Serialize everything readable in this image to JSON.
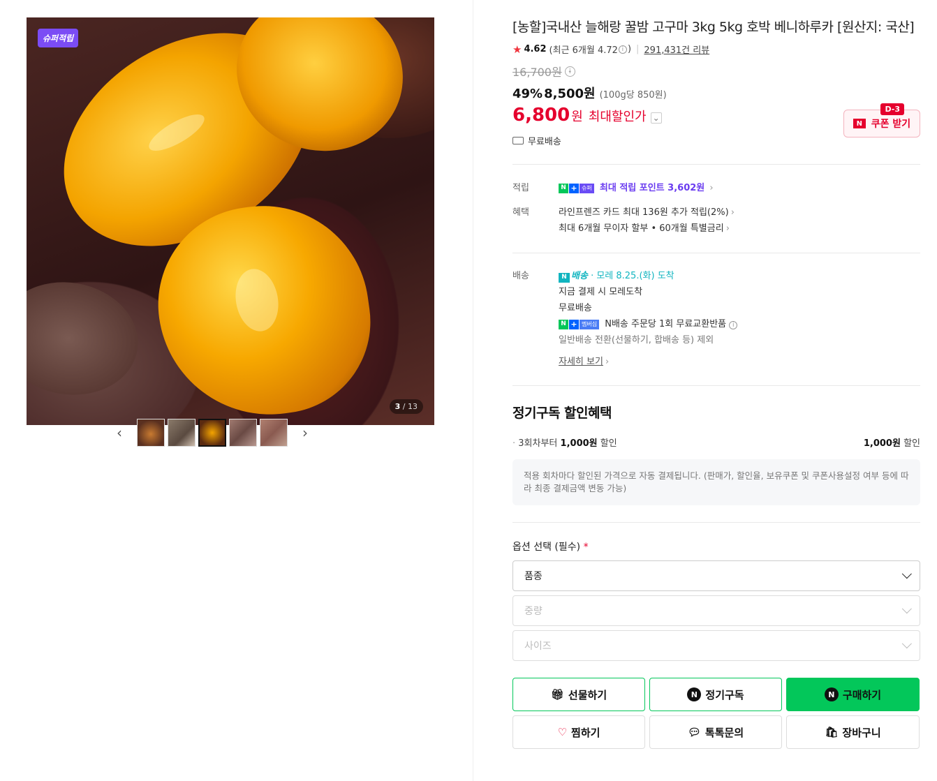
{
  "gallery": {
    "badge": "슈퍼적립",
    "counter_current": "3",
    "counter_total": "/ 13",
    "prev_icon": "chevron-left-icon",
    "next_icon": "chevron-right-icon",
    "thumbnail_count": 5,
    "active_thumbnail": 3
  },
  "product": {
    "title": "[농할]국내산 늘해랑 꿀밤 고구마 3kg 5kg 호박 베니하루카 [원산지: 국산]",
    "rating": "4.62",
    "rating_recent_prefix": "(최근 6개월 4.72",
    "rating_recent_suffix": ")",
    "review_count": "291,431건 리뷰",
    "original_price": "16,700원",
    "discount_rate": "49%",
    "sale_price": "8,500원",
    "unit_price": "(100g당 850원)",
    "max_discount_price": "6,800",
    "max_discount_won": "원",
    "max_discount_label": "최대할인가",
    "free_shipping": "무료배송"
  },
  "coupon": {
    "dday": "D-3",
    "label": "쿠폰 받기",
    "n_mark": "N"
  },
  "benefits": {
    "points_label": "적립",
    "points_tag": "슈퍼",
    "points_text": "최대 적립 포인트 3,602원",
    "perks_label": "혜택",
    "perk_1": "라인프렌즈 카드 최대 136원 추가 적립(2%)",
    "perk_2": "최대 6개월 무이자 할부 • 60개월 특별금리"
  },
  "delivery": {
    "label": "배송",
    "service": "배송",
    "arrive": "· 모레 8.25.(화) 도착",
    "line_1": "지금 결제 시 모레도착",
    "line_2": "무료배송",
    "member_tag": "멤버십",
    "line_3": "N배송 주문당 1회 무료교환반품",
    "line_4": "일반배송 전환(선물하기, 합배송 등) 제외",
    "detail_link": "자세히 보기"
  },
  "subscription": {
    "title": "정기구독 할인혜택",
    "condition_prefix": "3회차부터",
    "condition_amount": "1,000원",
    "condition_suffix": "할인",
    "right_amount": "1,000원",
    "right_suffix": "할인",
    "notice": "적용 회차마다 할인된 가격으로 자동 결제됩니다. (판매가, 할인율, 보유쿠폰 및 쿠폰사용설정 여부 등에 따라 최종 결제금액 변동 가능)"
  },
  "options": {
    "label": "옵션 선택 (필수)",
    "required_mark": "*",
    "select_1": "품종",
    "select_2": "중량",
    "select_3": "사이즈"
  },
  "actions": {
    "gift": "선물하기",
    "subscribe": "정기구독",
    "buy": "구매하기",
    "wish": "찜하기",
    "talk": "톡톡문의",
    "cart": "장바구니"
  },
  "colors": {
    "accent_green": "#03c75a",
    "price_red": "#e5002d",
    "super_purple": "#7b4cf5",
    "delivery_teal": "#12b5c0"
  }
}
